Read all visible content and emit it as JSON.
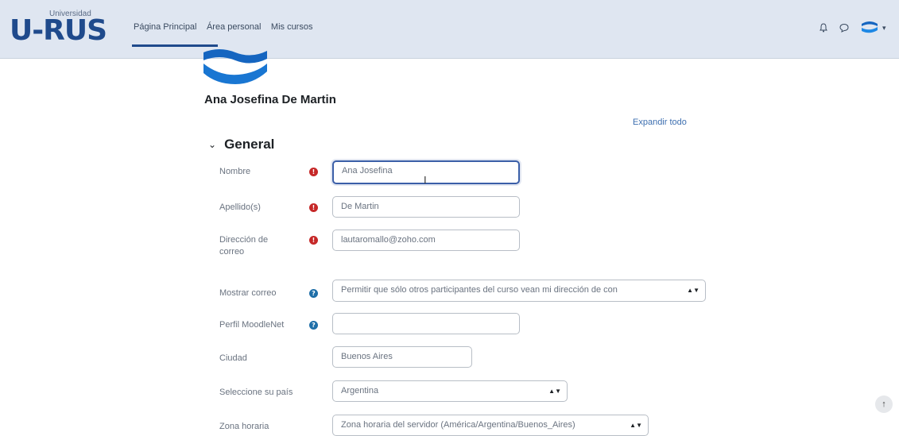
{
  "logo": {
    "brand": "U-RUS",
    "subtitle": "Universidad"
  },
  "nav": {
    "links": [
      "Página Principal",
      "Área personal",
      "Mis cursos"
    ]
  },
  "profile": {
    "name": "Ana Josefina De Martin"
  },
  "expand_all": "Expandir todo",
  "section": {
    "title": "General"
  },
  "fields": {
    "nombre": {
      "label": "Nombre",
      "value": "Ana Josefina"
    },
    "apellido": {
      "label": "Apellido(s)",
      "value": "De Martin"
    },
    "correo": {
      "label": "Dirección de correo",
      "value": "lautaromallo@zoho.com"
    },
    "mostrar_correo": {
      "label": "Mostrar correo",
      "value": "Permitir que sólo otros participantes del curso vean mi dirección de con"
    },
    "moodlenet": {
      "label": "Perfil MoodleNet",
      "value": ""
    },
    "ciudad": {
      "label": "Ciudad",
      "value": "Buenos Aires"
    },
    "pais": {
      "label": "Seleccione su país",
      "value": "Argentina"
    },
    "zona": {
      "label": "Zona horaria",
      "value": "Zona horaria del servidor (América/Argentina/Buenos_Aires)"
    }
  },
  "icons": {
    "required": "required-icon",
    "help": "help-icon",
    "bell": "bell-icon",
    "chat": "chat-icon",
    "chevron": "chevron-down-icon",
    "scroll_top": "arrow-up-icon"
  },
  "colors": {
    "accent": "#1f4a8c",
    "navbar": "#dfe6f1",
    "required": "#c62828",
    "help": "#1f6fa8",
    "link": "#3d6fb0"
  }
}
